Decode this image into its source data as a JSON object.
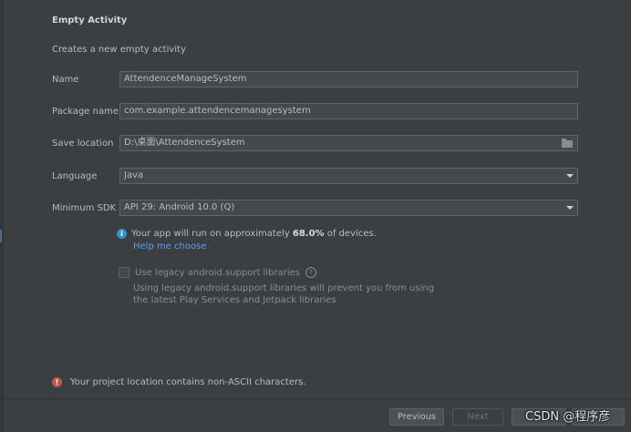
{
  "header": {
    "title": "Empty Activity",
    "subtitle": "Creates a new empty activity"
  },
  "form": {
    "name_label": "Name",
    "name_value": "AttendenceManageSystem",
    "package_label": "Package name",
    "package_value": "com.example.attendencemanagesystem",
    "location_label": "Save location",
    "location_value": "D:\\桌面\\AttendenceSystem",
    "language_label": "Language",
    "language_value": "Java",
    "sdk_label": "Minimum SDK",
    "sdk_value": "API 29: Android 10.0 (Q)"
  },
  "info": {
    "prefix": "Your app will run on approximately ",
    "percent": "68.0%",
    "suffix": " of devices.",
    "help_link": "Help me choose"
  },
  "legacy": {
    "checkbox_label": "Use legacy android.support libraries",
    "checked": false,
    "description_line1": "Using legacy android.support libraries will prevent you from using",
    "description_line2": "the latest Play Services and Jetpack libraries"
  },
  "error": {
    "message": "Your project location contains non-ASCII characters."
  },
  "footer": {
    "previous_label": "Previous",
    "next_label": "Next"
  },
  "watermark": "CSDN @程序彦",
  "colors": {
    "background": "#3c3f41",
    "field_background": "#45494a",
    "link": "#589df6",
    "info": "#3592c4",
    "error": "#c75450"
  },
  "icons": {
    "info": "info-icon",
    "help": "question-icon",
    "error": "error-icon",
    "folder": "folder-icon",
    "dropdown": "chevron-down-icon"
  }
}
